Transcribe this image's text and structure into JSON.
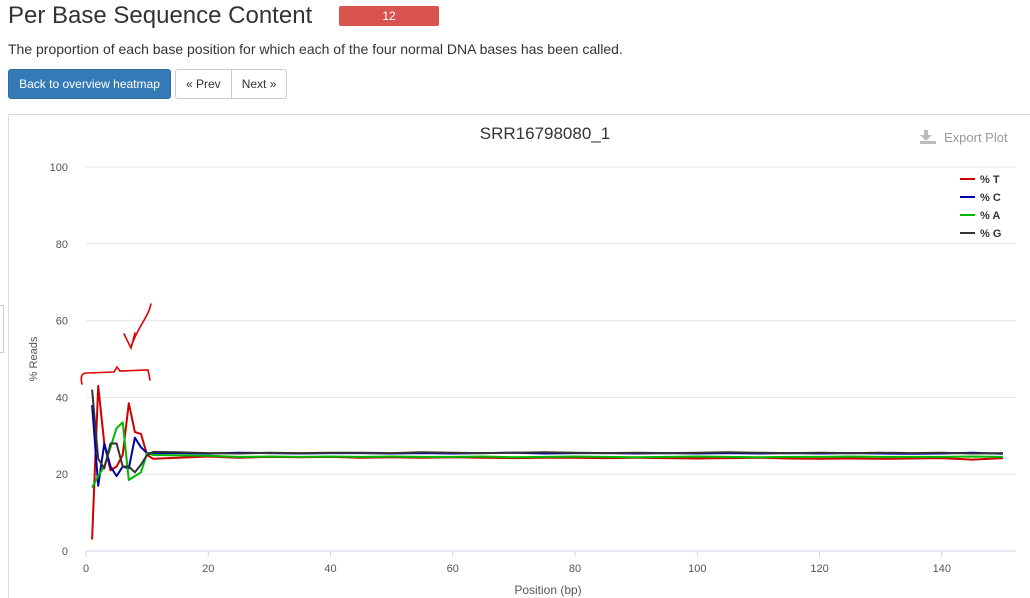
{
  "header": {
    "title": "Per Base Sequence Content",
    "badge_count": "12",
    "description": "The proportion of each base position for which each of the four normal DNA bases has been called."
  },
  "buttons": {
    "back": "Back to overview heatmap",
    "prev": "« Prev",
    "next": "Next »"
  },
  "export": {
    "label": "Export Plot",
    "icon": "download-icon"
  },
  "colors": {
    "badge": "#d9534f",
    "primary": "#337ab7",
    "T": "#cc0000",
    "C": "#0000aa",
    "A": "#00bb00",
    "G": "#333333"
  },
  "chart_data": {
    "type": "line",
    "title": "SRR16798080_1",
    "xlabel": "Position (bp)",
    "ylabel": "% Reads",
    "xlim": [
      0,
      151
    ],
    "ylim": [
      0,
      100
    ],
    "x_ticks": [
      0,
      20,
      40,
      60,
      80,
      100,
      120,
      140
    ],
    "y_ticks": [
      0,
      20,
      40,
      60,
      80,
      100
    ],
    "grid": "horizontal",
    "legend_position": "top-right",
    "series": [
      {
        "name": "% T",
        "color": "#cc0000",
        "x": [
          1,
          2,
          3,
          4,
          5,
          6,
          7,
          8,
          9,
          10,
          11,
          15,
          20,
          25,
          30,
          35,
          40,
          45,
          50,
          55,
          60,
          65,
          70,
          75,
          80,
          85,
          90,
          95,
          100,
          105,
          110,
          115,
          120,
          125,
          130,
          135,
          140,
          145,
          150
        ],
        "y": [
          3,
          43,
          28,
          21,
          22,
          25,
          38.5,
          31,
          30.5,
          25,
          24,
          24.3,
          24.6,
          24.3,
          24.5,
          24.4,
          24.5,
          24.3,
          24.4,
          24.3,
          24.4,
          24.3,
          24.2,
          24.3,
          24.3,
          24.2,
          24.3,
          24.2,
          24.1,
          24.2,
          24.3,
          24.1,
          24,
          24.1,
          24,
          24.1,
          24.2,
          23.8,
          24.2
        ]
      },
      {
        "name": "% C",
        "color": "#0000aa",
        "x": [
          1,
          2,
          3,
          4,
          5,
          6,
          7,
          8,
          9,
          10,
          11,
          15,
          20,
          25,
          30,
          35,
          40,
          45,
          50,
          55,
          60,
          65,
          70,
          75,
          80,
          85,
          90,
          95,
          100,
          105,
          110,
          115,
          120,
          125,
          130,
          135,
          140,
          145,
          150
        ],
        "y": [
          38,
          17,
          28,
          22,
          19.5,
          22,
          21.5,
          29.5,
          27,
          25.5,
          25.5,
          25.5,
          25.4,
          25.6,
          25.5,
          25.4,
          25.5,
          25.5,
          25.4,
          25.5,
          25.4,
          25.5,
          25.6,
          25.4,
          25.5,
          25.5,
          25.4,
          25.5,
          25.4,
          25.5,
          25.4,
          25.5,
          25.4,
          25.5,
          25.4,
          25.3,
          25.4,
          25.6,
          25.3
        ]
      },
      {
        "name": "% A",
        "color": "#00bb00",
        "x": [
          1,
          2,
          3,
          4,
          5,
          6,
          7,
          8,
          9,
          10,
          11,
          15,
          20,
          25,
          30,
          35,
          40,
          45,
          50,
          55,
          60,
          65,
          70,
          75,
          80,
          85,
          90,
          95,
          100,
          105,
          110,
          115,
          120,
          125,
          130,
          135,
          140,
          145,
          150
        ],
        "y": [
          16.5,
          19.5,
          22,
          27,
          32,
          33.5,
          18.5,
          19.5,
          20.5,
          25.5,
          25,
          24.9,
          24.8,
          24.5,
          24.6,
          24.5,
          24.6,
          24.5,
          24.6,
          24.5,
          24.5,
          24.6,
          24.4,
          24.5,
          24.6,
          24.5,
          24.4,
          24.5,
          24.6,
          24.5,
          24.4,
          24.5,
          24.5,
          24.6,
          24.5,
          24.5,
          24.5,
          24.6,
          24.5
        ]
      },
      {
        "name": "% G",
        "color": "#333333",
        "x": [
          1,
          2,
          3,
          4,
          5,
          6,
          7,
          8,
          9,
          10,
          11,
          15,
          20,
          25,
          30,
          35,
          40,
          45,
          50,
          55,
          60,
          65,
          70,
          75,
          80,
          85,
          90,
          95,
          100,
          105,
          110,
          115,
          120,
          125,
          130,
          135,
          140,
          145,
          150
        ],
        "y": [
          42,
          24,
          21.5,
          28,
          28,
          22,
          22,
          20.5,
          22.5,
          25,
          25.8,
          25.7,
          25.5,
          25.4,
          25.6,
          25.5,
          25.6,
          25.6,
          25.5,
          25.7,
          25.6,
          25.5,
          25.6,
          25.7,
          25.6,
          25.5,
          25.6,
          25.5,
          25.6,
          25.7,
          25.6,
          25.5,
          25.6,
          25.5,
          25.6,
          25.5,
          25.6,
          25.4,
          25.5
        ]
      }
    ]
  }
}
